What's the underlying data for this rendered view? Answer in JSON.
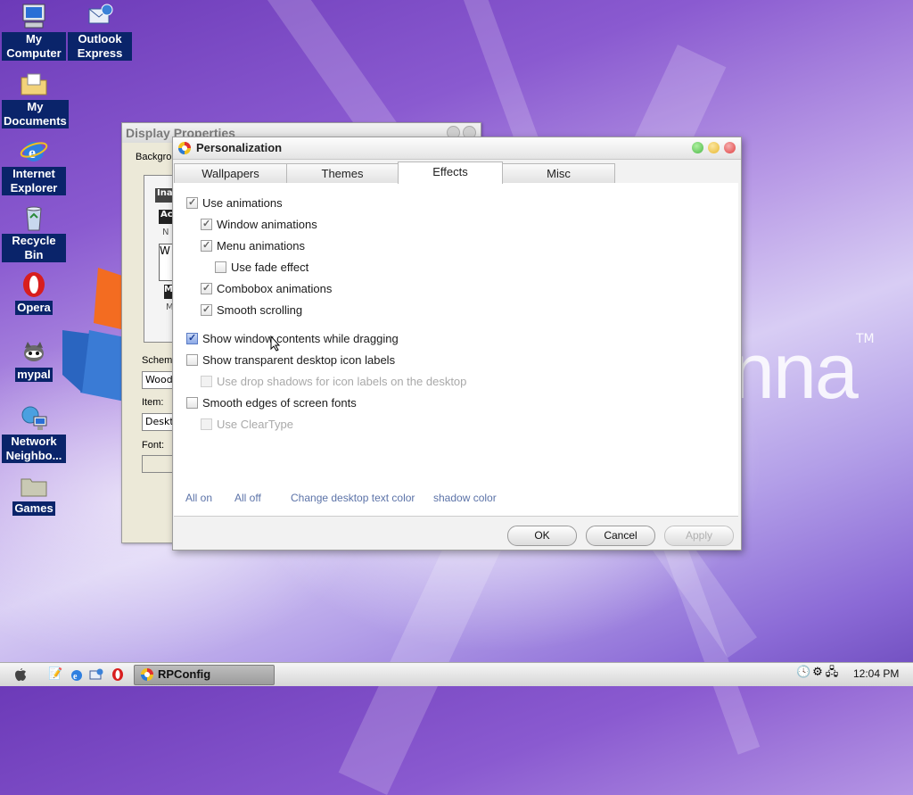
{
  "desktop": {
    "icons": [
      {
        "label": "My Computer",
        "icon": "computer-icon"
      },
      {
        "label": "Outlook Express",
        "icon": "outlook-express-icon"
      },
      {
        "label": "My Documents",
        "icon": "folder-documents-icon"
      },
      {
        "label": "Internet Explorer",
        "icon": "internet-explorer-icon"
      },
      {
        "label": "Recycle Bin",
        "icon": "recycle-bin-icon"
      },
      {
        "label": "Opera",
        "icon": "opera-icon"
      },
      {
        "label": "mypal",
        "icon": "mypal-icon"
      },
      {
        "label": "Network Neighbo...",
        "icon": "network-icon"
      },
      {
        "label": "Games",
        "icon": "folder-icon"
      }
    ],
    "brand_text": "nna",
    "brand_tm": "TM"
  },
  "background_window": {
    "title": "Display Properties",
    "tab_partial": "Backgrou",
    "scheme_label": "Scheme",
    "scheme_value": "Woode",
    "item_label": "Item:",
    "item_value": "Deskto",
    "font_label": "Font:",
    "preview": {
      "inactive": "Ina",
      "active": "Ac",
      "normal": "N",
      "window": "W",
      "message": "M",
      "msg_text": "M"
    }
  },
  "dialog": {
    "title": "Personalization",
    "tabs": [
      {
        "label": "Wallpapers",
        "active": false
      },
      {
        "label": "Themes",
        "active": false
      },
      {
        "label": "Effects",
        "active": true
      },
      {
        "label": "Misc",
        "active": false
      }
    ],
    "options": [
      {
        "label": "Use animations",
        "checked": true,
        "disabled": false
      },
      {
        "label": "Window animations",
        "checked": true,
        "disabled": false
      },
      {
        "label": "Menu animations",
        "checked": true,
        "disabled": false
      },
      {
        "label": "Use fade effect",
        "checked": false,
        "disabled": false
      },
      {
        "label": "Combobox animations",
        "checked": true,
        "disabled": false
      },
      {
        "label": "Smooth scrolling",
        "checked": true,
        "disabled": false
      },
      {
        "label": "Show window contents while dragging",
        "checked": true,
        "disabled": false
      },
      {
        "label": "Show transparent desktop icon labels",
        "checked": false,
        "disabled": false
      },
      {
        "label": "Use drop shadows for icon labels on the desktop",
        "checked": false,
        "disabled": true
      },
      {
        "label": "Smooth edges of screen fonts",
        "checked": false,
        "disabled": false
      },
      {
        "label": "Use ClearType",
        "checked": false,
        "disabled": true
      }
    ],
    "links": {
      "all_on": "All on",
      "all_off": "All off",
      "change_text_color": "Change desktop text color",
      "shadow_color": "shadow color"
    },
    "buttons": {
      "ok": "OK",
      "cancel": "Cancel",
      "apply": "Apply"
    }
  },
  "taskbar": {
    "task_label": "RPConfig",
    "clock": "12:04 PM"
  },
  "colors": {
    "accent_link": "#5c73a8",
    "label_bg": "#0a246a",
    "close_btn": "#e04040",
    "min_btn": "#e8b830",
    "max_btn": "#4cb848"
  }
}
